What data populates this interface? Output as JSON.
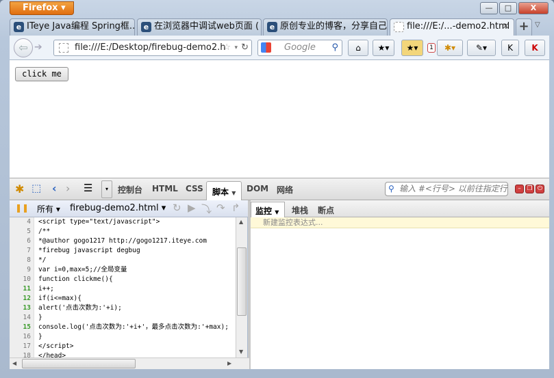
{
  "browser": {
    "menu_button": "Firefox",
    "window_controls": {
      "minimize": "—",
      "maximize": "□",
      "close": "X"
    }
  },
  "tabs": [
    {
      "title": "ITeye Java编程 Spring框...",
      "icon": "iteye-icon"
    },
    {
      "title": "在浏览器中调试web页面 ( ...",
      "icon": "iteye-icon"
    },
    {
      "title": "原创专业的博客，分享自己...",
      "icon": "iteye-icon"
    },
    {
      "title": "file:///E:/...-demo2.html",
      "icon": "blank-page-icon",
      "active": true,
      "close": "×"
    }
  ],
  "new_tab": "+",
  "nav": {
    "url": "file:///E:/Desktop/firebug-demo2.h",
    "search_placeholder": "Google",
    "badge": "1"
  },
  "page": {
    "button": "click me"
  },
  "firebug": {
    "tabs": [
      "控制台",
      "HTML",
      "CSS",
      "脚本",
      "DOM",
      "网络"
    ],
    "active_tab": "脚本",
    "search_placeholder": "输入 #<行号> 以前往指定行",
    "script_filter": "所有",
    "script_file": "firebug-demo2.html",
    "side_tabs": [
      "监控",
      "堆栈",
      "断点"
    ],
    "watch_placeholder": "新建监控表达式...",
    "code": [
      {
        "n": "4",
        "text": "<script type=\"text/javascript\">",
        "bp": false
      },
      {
        "n": "5",
        "text": "/**",
        "bp": false
      },
      {
        "n": "6",
        "text": "*@author gogo1217 http://gogo1217.iteye.com",
        "bp": false
      },
      {
        "n": "7",
        "text": "*firebug javascript degbug",
        "bp": false
      },
      {
        "n": "8",
        "text": "*/",
        "bp": false
      },
      {
        "n": "9",
        "text": "var i=0,max=5;//全局变量",
        "bp": false
      },
      {
        "n": "10",
        "text": "function clickme(){",
        "bp": false
      },
      {
        "n": "11",
        "text": "i++;",
        "bp": true
      },
      {
        "n": "12",
        "text": "if(i<=max){",
        "bp": true
      },
      {
        "n": "13",
        "text": "alert('点击次数为:'+i);",
        "bp": true
      },
      {
        "n": "14",
        "text": "}",
        "bp": false
      },
      {
        "n": "15",
        "text": "console.log('点击次数为:'+i+'，最多点击次数为:'+max);",
        "bp": true
      },
      {
        "n": "16",
        "text": "}",
        "bp": false
      },
      {
        "n": "17",
        "text": "</script>",
        "bp": false
      },
      {
        "n": "18",
        "text": "</head>",
        "bp": false
      }
    ]
  }
}
